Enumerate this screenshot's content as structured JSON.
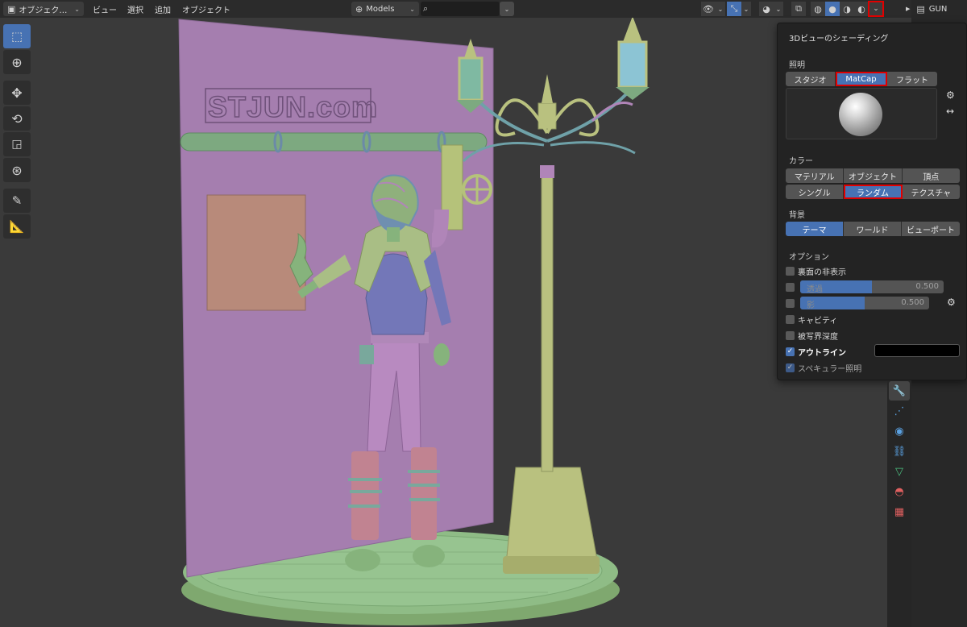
{
  "header": {
    "mode": "オブジェク…",
    "menus": [
      "ビュー",
      "選択",
      "追加",
      "オブジェクト"
    ],
    "collection": "Models",
    "search_placeholder": ""
  },
  "outliner": {
    "item_label": "GUN"
  },
  "scene": {
    "sign_text": "STJUN.com"
  },
  "shading_popover": {
    "title": "3Dビューのシェーディング",
    "lighting_label": "照明",
    "lighting_options": [
      "スタジオ",
      "MatCap",
      "フラット"
    ],
    "lighting_selected": "MatCap",
    "color_label": "カラー",
    "color_options_row1": [
      "マテリアル",
      "オブジェクト",
      "頂点"
    ],
    "color_options_row2": [
      "シングル",
      "ランダム",
      "テクスチャ"
    ],
    "color_selected": "ランダム",
    "background_label": "背景",
    "background_options": [
      "テーマ",
      "ワールド",
      "ビューポート"
    ],
    "background_selected": "テーマ",
    "options_label": "オプション",
    "opt_backface": "裏面の非表示",
    "opt_xray": "透過",
    "opt_xray_value": "0.500",
    "opt_xray_level": 0.5,
    "opt_shadow": "影",
    "opt_shadow_value": "0.500",
    "opt_shadow_level": 0.5,
    "opt_cavity": "キャビティ",
    "opt_dof": "被写界深度",
    "opt_outline": "アウトライン",
    "opt_specular": "スペキュラー照明",
    "outline_color": "#000000"
  },
  "colors": {
    "accent": "#4772b3",
    "highlight": "#e00000",
    "header_bg": "#2b2b2b",
    "viewport_bg": "#3a3a3a"
  }
}
